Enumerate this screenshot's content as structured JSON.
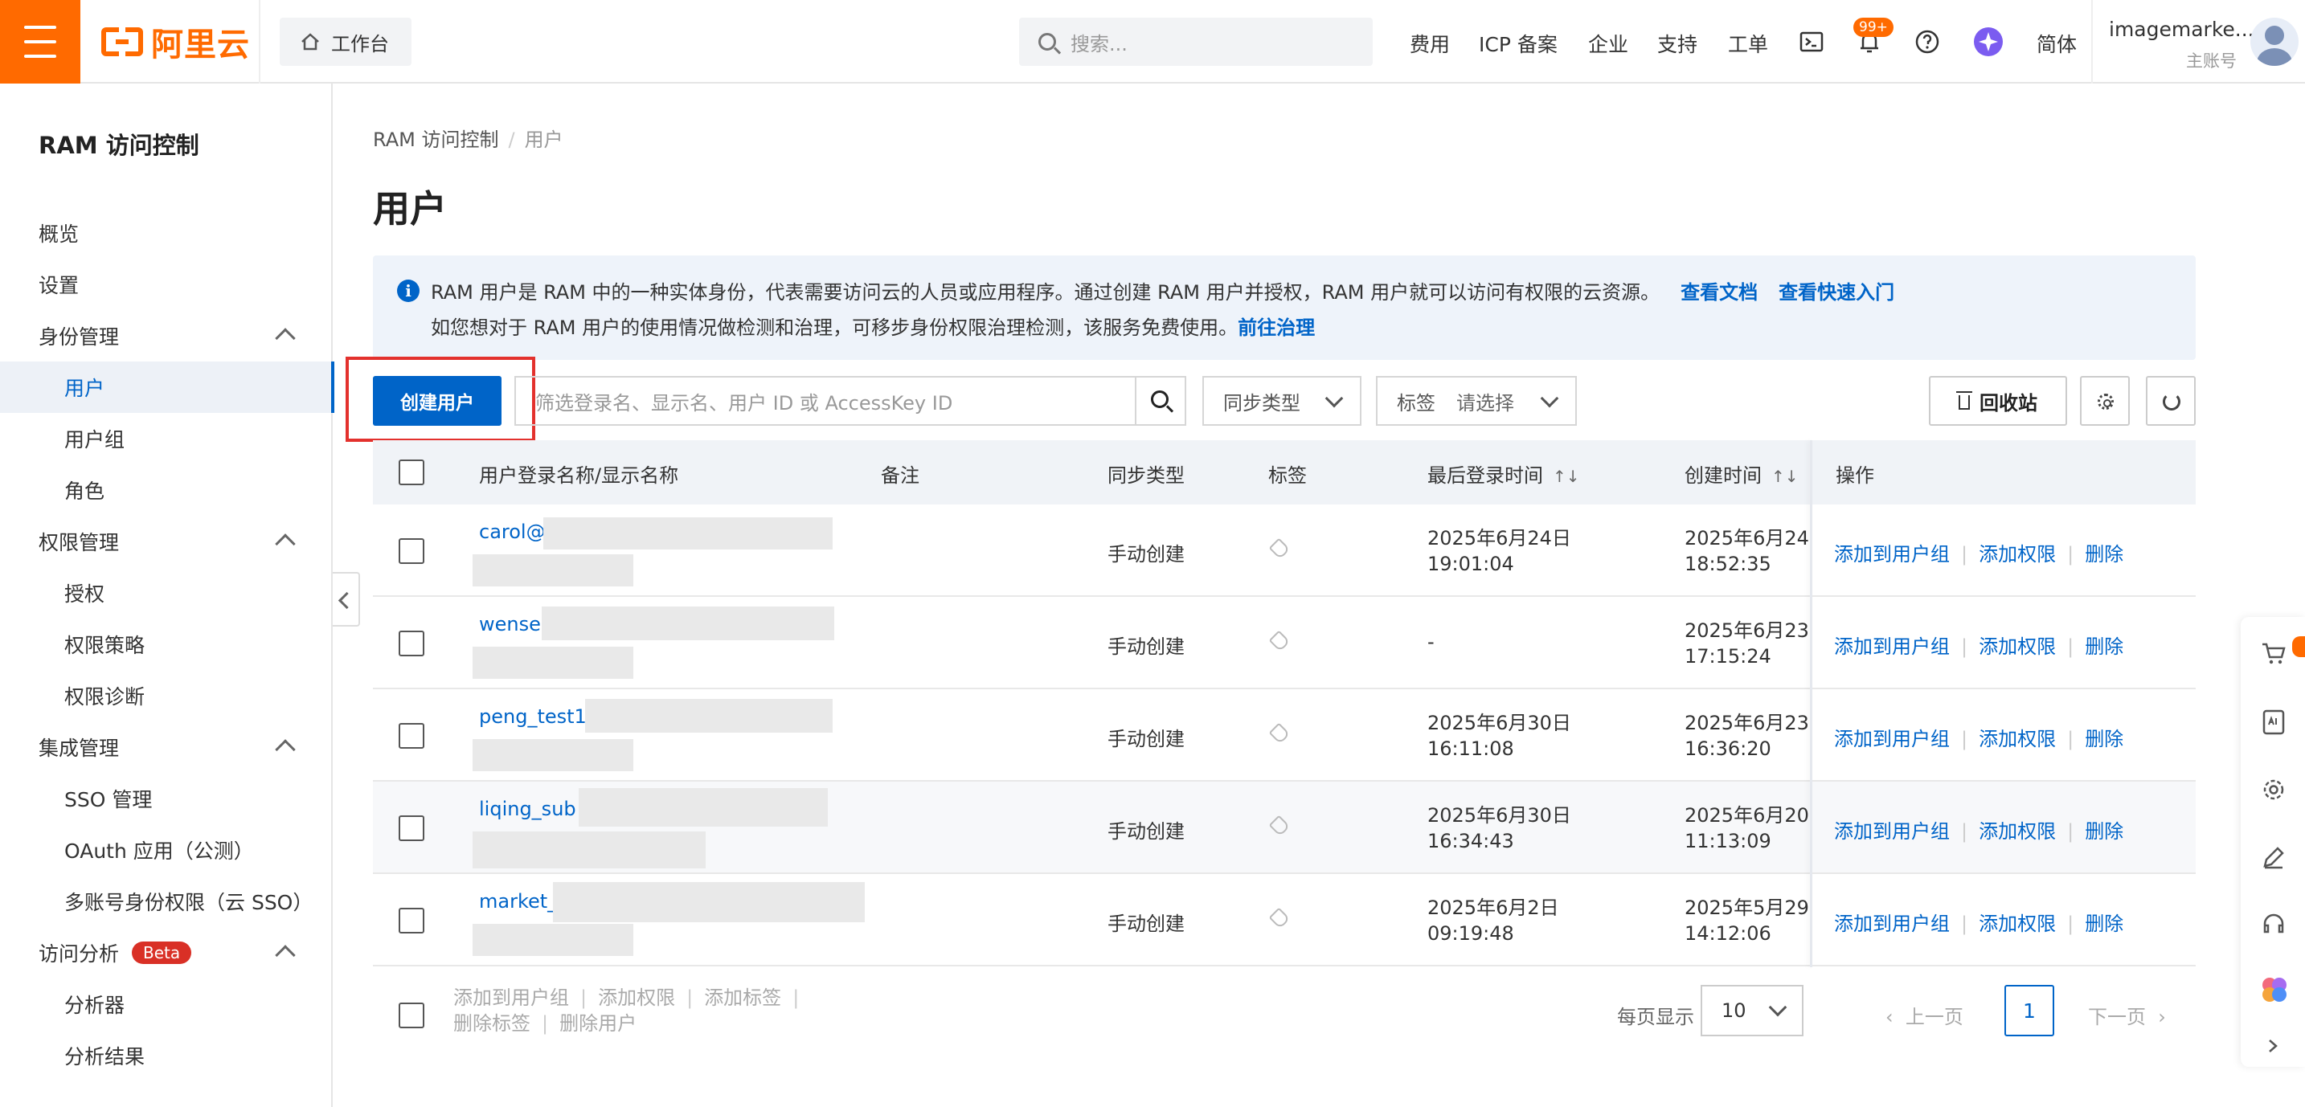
{
  "topbar": {
    "brand": "阿里云",
    "workbench": "工作台",
    "search_placeholder": "搜索...",
    "links": [
      "费用",
      "ICP 备案",
      "企业",
      "支持",
      "工单"
    ],
    "notification_badge": "99+",
    "language": "简体",
    "user_name": "imagemarke...",
    "user_role": "主账号"
  },
  "sidebar": {
    "title": "RAM 访问控制",
    "items": [
      {
        "label": "概览"
      },
      {
        "label": "设置"
      },
      {
        "label": "身份管理"
      },
      {
        "label": "用户"
      },
      {
        "label": "用户组"
      },
      {
        "label": "角色"
      },
      {
        "label": "权限管理"
      },
      {
        "label": "授权"
      },
      {
        "label": "权限策略"
      },
      {
        "label": "权限诊断"
      },
      {
        "label": "集成管理"
      },
      {
        "label": "SSO 管理"
      },
      {
        "label": "OAuth 应用（公测）"
      },
      {
        "label": "多账号身份权限（云 SSO）"
      },
      {
        "label": "访问分析"
      },
      {
        "label": "分析器"
      },
      {
        "label": "分析结果"
      }
    ],
    "beta_badge": "Beta"
  },
  "breadcrumb": {
    "root": "RAM 访问控制",
    "sep": "/",
    "current": "用户"
  },
  "page_title": "用户",
  "info": {
    "line1": "RAM 用户是 RAM 中的一种实体身份，代表需要访问云的人员或应用程序。通过创建 RAM 用户并授权，RAM 用户就可以访问有权限的云资源。",
    "doc_link": "查看文档",
    "quickstart_link": "查看快速入门",
    "line2": "如您想对于 RAM 用户的使用情况做检测和治理，可移步身份权限治理检测，该服务免费使用。",
    "governance_link": "前往治理"
  },
  "toolbar": {
    "create_user": "创建用户",
    "filter_placeholder": "筛选登录名、显示名、用户 ID 或 AccessKey ID",
    "sync_type": "同步类型",
    "tag_label": "标签",
    "tag_placeholder": "请选择",
    "recycle_bin": "回收站"
  },
  "table": {
    "columns": [
      "用户登录名称/显示名称",
      "备注",
      "同步类型",
      "标签",
      "最后登录时间",
      "创建时间",
      "操作"
    ],
    "rows": [
      {
        "name": "carol@",
        "sync": "手动创建",
        "last_login_date": "2025年6月24日",
        "last_login_time": "19:01:04",
        "created_date": "2025年6月24",
        "created_time": "18:52:35"
      },
      {
        "name": "wenser",
        "sync": "手动创建",
        "last_login_date": "-",
        "last_login_time": "",
        "created_date": "2025年6月23",
        "created_time": "17:15:24"
      },
      {
        "name": "peng_test1",
        "sync": "手动创建",
        "last_login_date": "2025年6月30日",
        "last_login_time": "16:11:08",
        "created_date": "2025年6月23",
        "created_time": "16:36:20"
      },
      {
        "name": "liqing_sub",
        "sync": "手动创建",
        "last_login_date": "2025年6月30日",
        "last_login_time": "16:34:43",
        "created_date": "2025年6月20",
        "created_time": "11:13:09"
      },
      {
        "name": "market_",
        "sync": "手动创建",
        "last_login_date": "2025年6月2日",
        "last_login_time": "09:19:48",
        "created_date": "2025年5月29",
        "created_time": "14:12:06"
      }
    ],
    "row_actions": {
      "add_to_group": "添加到用户组",
      "add_permission": "添加权限",
      "delete": "删除"
    }
  },
  "footer": {
    "bulk_actions": [
      "添加到用户组",
      "添加权限",
      "添加标签",
      "删除标签",
      "删除用户"
    ],
    "per_page_label": "每页显示",
    "per_page_value": "10",
    "prev": "上一页",
    "current_page": "1",
    "next": "下一页"
  },
  "colors": {
    "brand": "#ff6a00",
    "primary": "#0064c8",
    "highlight": "#e3312d"
  }
}
